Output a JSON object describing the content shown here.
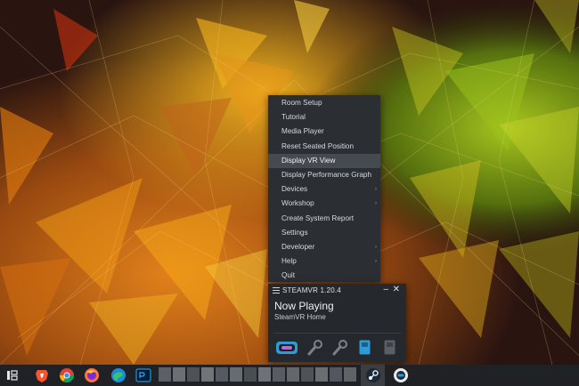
{
  "context_menu": {
    "items": [
      {
        "label": "Room Setup",
        "submenu": false,
        "active": false
      },
      {
        "label": "Tutorial",
        "submenu": false,
        "active": false
      },
      {
        "label": "Media Player",
        "submenu": false,
        "active": false
      },
      {
        "label": "Reset Seated Position",
        "submenu": false,
        "active": false
      },
      {
        "label": "Display VR View",
        "submenu": false,
        "active": true
      },
      {
        "label": "Display Performance Graph",
        "submenu": false,
        "active": false
      },
      {
        "label": "Devices",
        "submenu": true,
        "active": false
      },
      {
        "label": "Workshop",
        "submenu": true,
        "active": false
      },
      {
        "label": "Create System Report",
        "submenu": false,
        "active": false
      },
      {
        "label": "Settings",
        "submenu": false,
        "active": false
      },
      {
        "label": "Developer",
        "submenu": true,
        "active": false
      },
      {
        "label": "Help",
        "submenu": true,
        "active": false
      },
      {
        "label": "Quit",
        "submenu": false,
        "active": false
      }
    ],
    "submenu_glyph": "›"
  },
  "steamvr_window": {
    "title": "STEAMVR 1.20.4",
    "minimize_glyph": "–",
    "close_glyph": "✕",
    "status_heading": "Now Playing",
    "status_app": "SteamVR Home",
    "devices": [
      "headset-icon",
      "controller-icon",
      "controller-icon",
      "base-station-icon",
      "base-station-icon"
    ]
  },
  "taskbar": {
    "icons": [
      "task-view-icon",
      "brave-icon",
      "chrome-icon",
      "firefox-icon",
      "edge-icon",
      "photoshop-icon"
    ],
    "tray_icons": [
      "steam-icon",
      "steamvr-icon"
    ]
  },
  "colors": {
    "menu_bg": "#2b2e33",
    "menu_active": "#454a51",
    "window_bg": "#25282d",
    "taskbar_bg": "#1f2124",
    "headset_accent": "#2e9bd6"
  }
}
